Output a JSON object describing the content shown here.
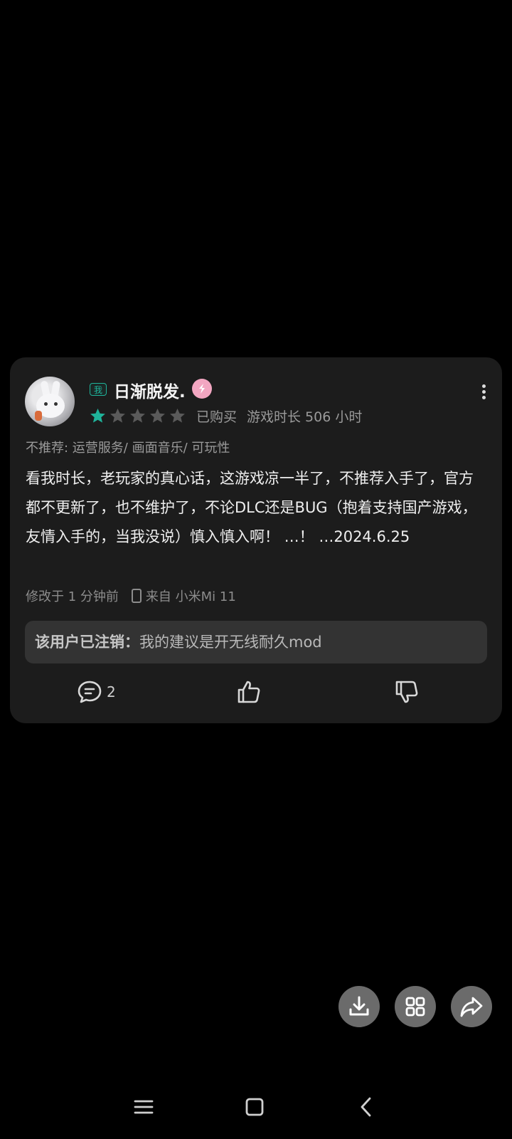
{
  "review": {
    "me_tag": "我",
    "username": "日渐脱发.",
    "rating": 1,
    "rating_max": 5,
    "purchased": "已购买",
    "playtime": "游戏时长 506 小时",
    "tags": "不推荐: 运营服务/ 画面音乐/ 可玩性",
    "body": "看我时长，老玩家的真心话，这游戏凉一半了，不推荐入手了，官方都不更新了，也不维护了，不论DLC还是BUG（抱着支持国产游戏，友情入手的，当我没说）慎入慎入啊！ …！ …2024.6.25",
    "edited": "修改于 1 分钟前",
    "device": "来自 小米Mi 11"
  },
  "reply": {
    "author": "该用户已注销：",
    "text": "我的建议是开无线耐久mod"
  },
  "actions": {
    "comment_count": "2"
  },
  "colors": {
    "accent": "#1fb39a",
    "card_bg": "#1c1c1c",
    "reply_bg": "#333333",
    "badge_pink": "#f2a6c1"
  },
  "icons": [
    "comment-icon",
    "thumbs-up-icon",
    "thumbs-down-icon",
    "download-icon",
    "grid-icon",
    "share-icon",
    "menu-icon",
    "home-icon",
    "back-icon"
  ]
}
